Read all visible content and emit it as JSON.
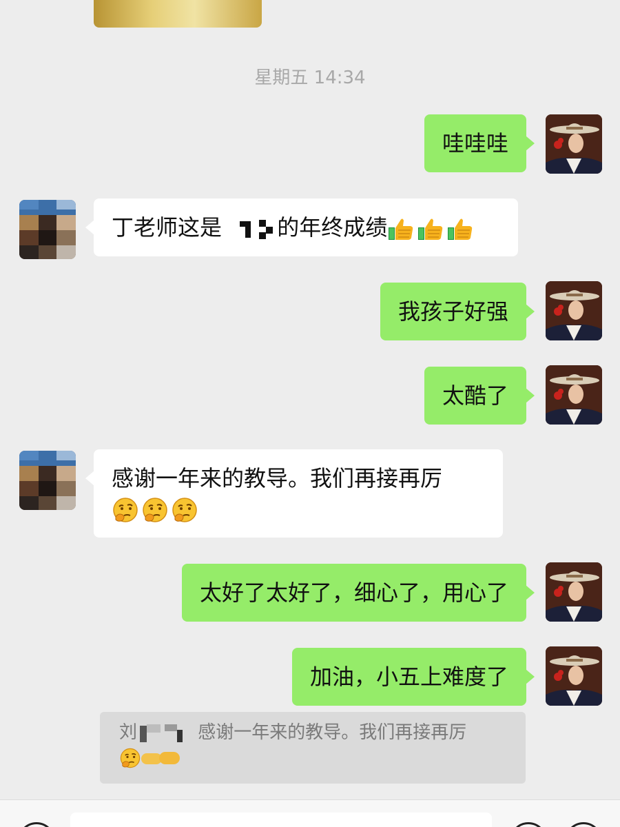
{
  "timestamp": "星期五 14:34",
  "messages": [
    {
      "side": "out",
      "text": "哇哇哇"
    },
    {
      "side": "in",
      "text_before": "丁老师这是",
      "text_after": "的年终成绩",
      "emoji": [
        "thumbs-up",
        "thumbs-up",
        "thumbs-up"
      ]
    },
    {
      "side": "out",
      "text": "我孩子好强"
    },
    {
      "side": "out",
      "text": "太酷了"
    },
    {
      "side": "in",
      "text": "感谢一年来的教导。我们再接再厉",
      "emoji": [
        "thinking-face",
        "thinking-face",
        "thinking-face"
      ]
    },
    {
      "side": "out",
      "text": "太好了太好了，细心了，用心了"
    },
    {
      "side": "out",
      "text": "加油，小五上难度了"
    }
  ],
  "quote": {
    "sender_initial": "刘",
    "text": "感谢一年来的教导。我们再接再厉",
    "emoji": [
      "thinking-face"
    ]
  },
  "colors": {
    "background": "#ededed",
    "outgoing_bubble": "#95ec69",
    "incoming_bubble": "#ffffff",
    "timestamp": "#a8a8a8"
  },
  "icons": {
    "voice_button": "voice-icon",
    "emoji_button": "emoji-icon",
    "plus_button": "plus-icon"
  }
}
